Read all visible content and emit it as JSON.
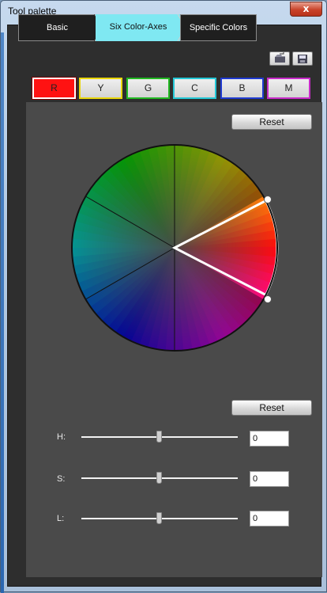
{
  "window": {
    "title": "Tool palette",
    "close_glyph": "x"
  },
  "tabs": [
    {
      "label": "Basic",
      "active": false
    },
    {
      "label": "Six Color-Axes",
      "active": true
    },
    {
      "label": "Specific Colors",
      "active": false
    }
  ],
  "toolbar_icons": [
    "load-settings-icon",
    "save-settings-icon"
  ],
  "color_axes": [
    {
      "label": "R",
      "color": "#ff1212",
      "selected": true
    },
    {
      "label": "Y",
      "color": "#e9d60b",
      "selected": false
    },
    {
      "label": "G",
      "color": "#22b822",
      "selected": false
    },
    {
      "label": "C",
      "color": "#24c7d6",
      "selected": false
    },
    {
      "label": "B",
      "color": "#1f3ad0",
      "selected": false
    },
    {
      "label": "M",
      "color": "#c72bc8",
      "selected": false
    }
  ],
  "wheel": {
    "reset_label": "Reset"
  },
  "adjust": {
    "reset_label": "Reset",
    "h_label": "H:",
    "h_value": "0",
    "s_label": "S:",
    "s_value": "0",
    "l_label": "L:",
    "l_value": "0"
  }
}
